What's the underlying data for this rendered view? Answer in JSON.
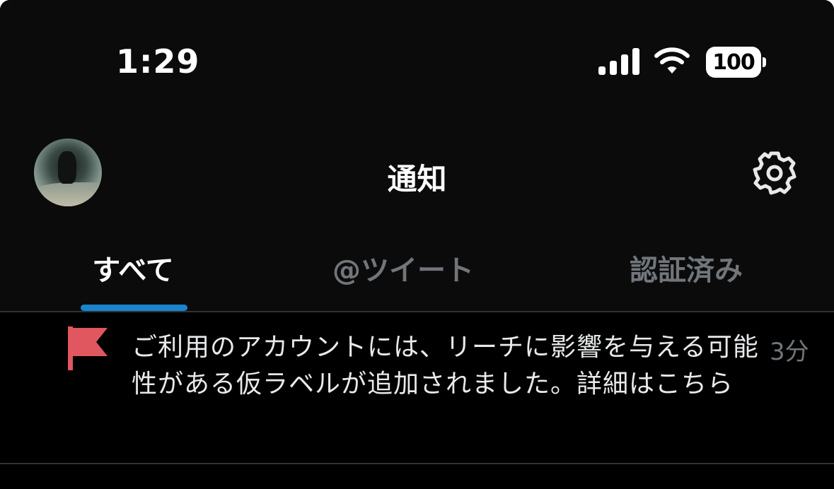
{
  "status_bar": {
    "time": "1:29",
    "battery_level": "100",
    "icons": [
      "signal-icon",
      "wifi-icon",
      "battery-icon"
    ]
  },
  "header": {
    "title": "通知",
    "avatar": "profile-avatar",
    "settings_icon": "gear-icon"
  },
  "tabs": [
    {
      "label": "すべて",
      "active": true
    },
    {
      "label": "@ツイート",
      "active": false
    },
    {
      "label": "認証済み",
      "active": false
    }
  ],
  "notifications": [
    {
      "icon": "flag-icon",
      "text": "ご利用のアカウントには、リーチに影響を与える可能性がある仮ラベルが追加されました。詳細はこちら",
      "time": "3分"
    }
  ],
  "colors": {
    "background": "#000000",
    "header_background": "#0b0b0c",
    "accent": "#1d9bf0",
    "flag": "#e0575f",
    "muted_text": "#71767b",
    "primary_text": "#e7e9ea"
  }
}
